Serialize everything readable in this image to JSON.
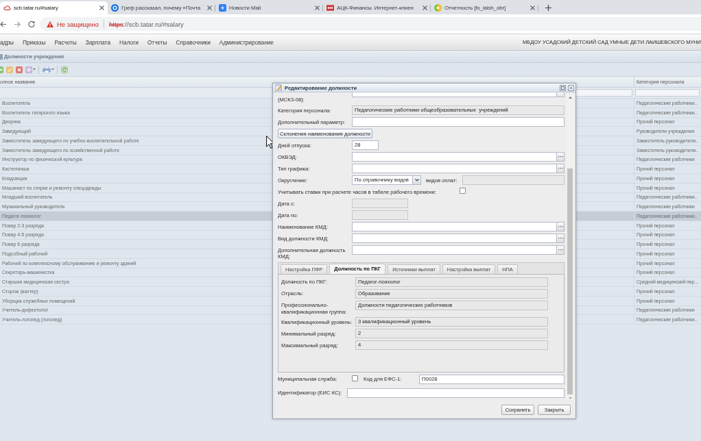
{
  "browser": {
    "tabs": [
      {
        "title": "scb.tatar.ru/#salary",
        "selected": true
      },
      {
        "title": "Греф рассказал, почему «Почта",
        "selected": false
      },
      {
        "title": "Новости Mail",
        "selected": false
      },
      {
        "title": "АЦК-Финансы. Интернет-клиен",
        "selected": false
      },
      {
        "title": "Отчетность [fo_laish_obr]",
        "selected": false
      }
    ],
    "address": {
      "secure": false,
      "security_label": "Не защищено",
      "scheme": "https",
      "rest": "://scb.tatar.ru/#salary"
    }
  },
  "menu": {
    "items": [
      "адры",
      "Приказы",
      "Расчеты",
      "Зарплата",
      "Налоги",
      "Отчеты",
      "Справочники",
      "Администрирование"
    ],
    "organization": "МБДОУ УСАДСКИЙ ДЕТСКИЙ САД УМНЫЕ ДЕТИ ЛАИШЕВСКОГО МУНИ"
  },
  "panel": {
    "title": "Должности учреждения"
  },
  "grid": {
    "columns": [
      "олное название",
      "Категория персонала"
    ],
    "rows": [
      {
        "name": "Воспитатель",
        "category": "Педагогические работники..",
        "selected": false
      },
      {
        "name": "Воспитатель татарского языка",
        "category": "Педагогические работники..",
        "selected": false
      },
      {
        "name": "Дворник",
        "category": "Прочий персонал",
        "selected": false
      },
      {
        "name": "Заведующий",
        "category": "Руководители учреждения",
        "selected": false
      },
      {
        "name": "Заместитель заведующего по учебно-воспитательной работе",
        "category": "Заместитель руководителя..",
        "selected": false
      },
      {
        "name": "Заместитель заведующего по хозяйственной работе",
        "category": "Заместитель руководителя..",
        "selected": false
      },
      {
        "name": "Инструктор по физической культуре",
        "category": "Педагогические работники",
        "selected": false
      },
      {
        "name": "Кастелянша",
        "category": "Прочий персонал",
        "selected": false
      },
      {
        "name": "Кладовщик",
        "category": "Прочий персонал",
        "selected": false
      },
      {
        "name": "Машинист по стирке и ремонту спецодежды",
        "category": "Прочий персонал",
        "selected": false
      },
      {
        "name": "Младший воспитатель",
        "category": "Педагогические работники..",
        "selected": false
      },
      {
        "name": "Музыкальный руководитель",
        "category": "Педагогические работники",
        "selected": false
      },
      {
        "name": "Педагог-психолог",
        "category": "Педагогические работники..",
        "selected": true
      },
      {
        "name": "Повар 2-3 разряда",
        "category": "Прочий персонал",
        "selected": false
      },
      {
        "name": "Повар 4-5 разряда",
        "category": "Прочий персонал",
        "selected": false
      },
      {
        "name": "Повар 6 разряда",
        "category": "Прочий персонал",
        "selected": false
      },
      {
        "name": "Подсобный рабочий",
        "category": "Прочий персонал",
        "selected": false
      },
      {
        "name": "Рабочий по комплексному обслуживанию и ремонту зданий",
        "category": "Прочий персонал",
        "selected": false
      },
      {
        "name": "Секретарь-машинистка",
        "category": "Прочий персонал",
        "selected": false
      },
      {
        "name": "Старшая медицинская сестра",
        "category": "Средний медицинский пер...",
        "selected": false
      },
      {
        "name": "Сторож (вахтер)",
        "category": "Прочий персонал",
        "selected": false
      },
      {
        "name": "Уборщик служебных помещений",
        "category": "Прочий персонал",
        "selected": false
      },
      {
        "name": "Учитель-дефектолог",
        "category": "Педагогические работники",
        "selected": false
      },
      {
        "name": "Учитель-логопед (логопед)",
        "category": "Педагогические работники..",
        "selected": false
      }
    ]
  },
  "dialog": {
    "title": "Редактирование должности",
    "fields": [
      {
        "kind": "trigger",
        "label": "(МСКЗ-08):",
        "clipped": true,
        "readonly": false
      },
      {
        "kind": "text",
        "label": "Категория персонала:",
        "value": "Педагогические работники общеобразовательных  учреждений",
        "readonly": true
      },
      {
        "kind": "text",
        "label": "Дополнительный параметр:",
        "readonly": false
      },
      {
        "kind": "button",
        "label": "Склонения наименования должности"
      },
      {
        "kind": "number",
        "label": "Дней отпуска:",
        "value": "28",
        "readonly": false
      },
      {
        "kind": "trigger",
        "label": "ОКВЭД:",
        "readonly": false
      },
      {
        "kind": "trigger",
        "label": "Тип графика:",
        "readonly": false
      },
      {
        "kind": "combo",
        "label": "Округление:",
        "value": "По справочнику видов",
        "extra_label": "видов оплат:",
        "extra_readonly": true
      },
      {
        "kind": "checkbox",
        "label": "Учитывать ставки при расчете часов в табеле рабочего времени:",
        "checked": false
      },
      {
        "kind": "date",
        "label": "Дата с:",
        "readonly": true
      },
      {
        "kind": "date",
        "label": "Дата по:",
        "readonly": true
      },
      {
        "kind": "trigger",
        "label": "Наименование КМД:",
        "readonly": false
      },
      {
        "kind": "trigger",
        "label": "Вид должности КМД:",
        "readonly": false
      },
      {
        "kind": "trigger",
        "label": "Дополнительная должность КМД:",
        "readonly": false
      }
    ],
    "tabs": [
      {
        "label": "Настройка ПФР",
        "selected": false
      },
      {
        "label": "Должность по ПКГ",
        "selected": true
      },
      {
        "label": "Источники выплат",
        "selected": false
      },
      {
        "label": "Настройка выплат",
        "selected": false
      },
      {
        "label": "НПА",
        "selected": false
      }
    ],
    "tab_fields": [
      {
        "label": "Должность по ПКГ:",
        "value": "Педагог-психолог",
        "readonly": true
      },
      {
        "label": "Отрасль:",
        "value": "Образование",
        "readonly": true
      },
      {
        "label": "Профессионально-квалификационная группа:",
        "value": "Должности педагогических работников",
        "readonly": true
      },
      {
        "label": "Квалификационный уровень:",
        "value": "3 квалификационный уровень",
        "readonly": true
      },
      {
        "label": "Минимальный разряд:",
        "value": "2",
        "readonly": true
      },
      {
        "label": "Максимальный разряд:",
        "value": "4",
        "readonly": true
      }
    ],
    "municipal": {
      "label": "Муниципальная служба:",
      "checked": false
    },
    "efs": {
      "label": "Код для ЕФС-1:",
      "value": "П0028",
      "readonly": false
    },
    "identifier": {
      "label": "Идентификатор (ЕИС КС):",
      "readonly": false
    },
    "buttons": [
      "Сохранить",
      "Закрыть"
    ]
  }
}
